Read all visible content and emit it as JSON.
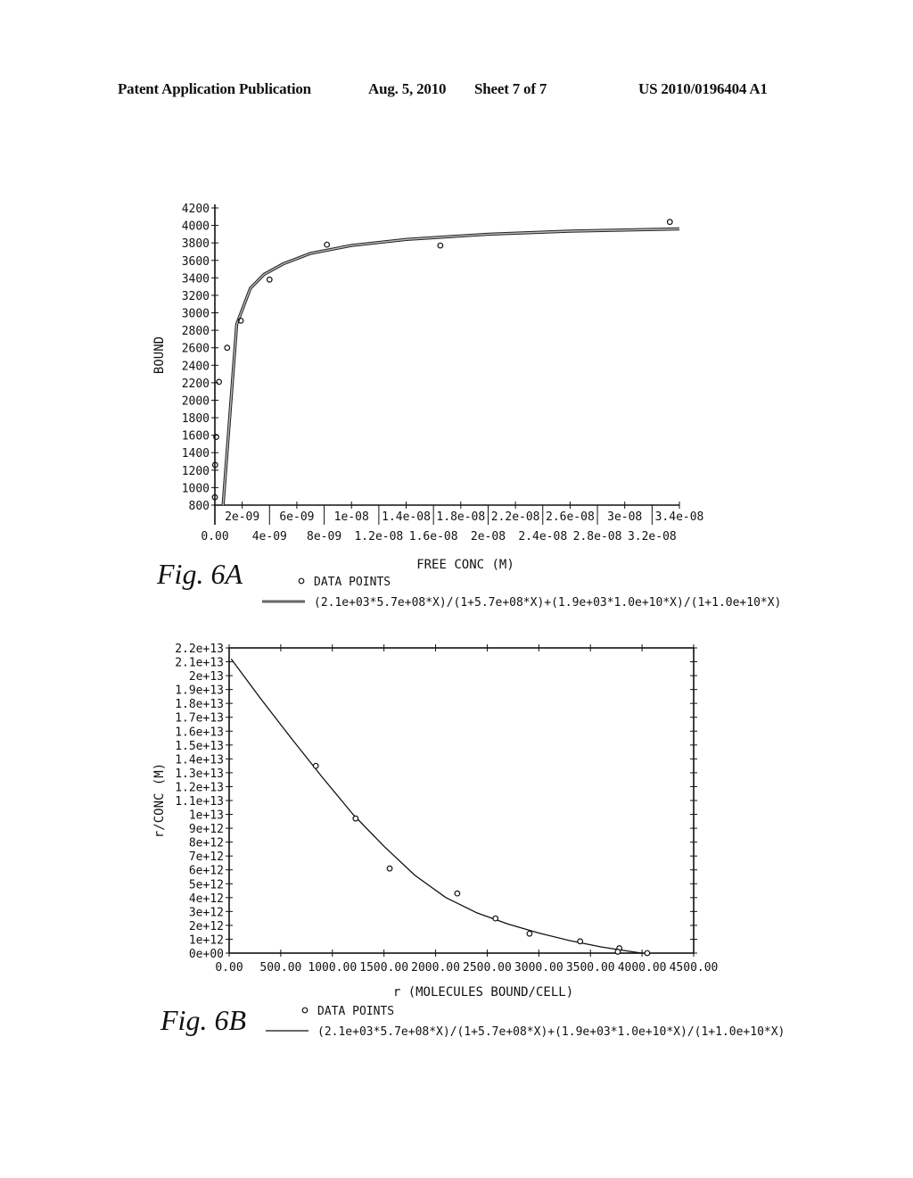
{
  "header": {
    "publication": "Patent Application Publication",
    "date": "Aug. 5, 2010",
    "sheet": "Sheet 7 of 7",
    "number": "US 2010/0196404 A1"
  },
  "chart_data": [
    {
      "id": "fig6a",
      "figure_label": "Fig. 6A",
      "type": "scatter",
      "title": "",
      "xlabel": "FREE CONC (M)",
      "ylabel": "BOUND",
      "xlim": [
        0,
        3.4e-08
      ],
      "ylim": [
        800,
        4200
      ],
      "grid": false,
      "x_ticks_lower": [
        "0.00",
        "4e-09",
        "8e-09",
        "1.2e-08",
        "1.6e-08",
        "2e-08",
        "2.4e-08",
        "2.8e-08",
        "3.2e-08"
      ],
      "x_ticks_lower_values": [
        0,
        4e-09,
        8e-09,
        1.2e-08,
        1.6e-08,
        2e-08,
        2.4e-08,
        2.8e-08,
        3.2e-08
      ],
      "x_ticks_upper": [
        "2e-09",
        "6e-09",
        "1e-08",
        "1.4e-08",
        "1.8e-08",
        "2.2e-08",
        "2.6e-08",
        "3e-08",
        "3.4e-08"
      ],
      "x_ticks_upper_values": [
        2e-09,
        6e-09,
        1e-08,
        1.4e-08,
        1.8e-08,
        2.2e-08,
        2.6e-08,
        3e-08,
        3.4e-08
      ],
      "y_ticks": [
        "800",
        "1000",
        "1200",
        "1400",
        "1600",
        "1800",
        "2000",
        "2200",
        "2400",
        "2600",
        "2800",
        "3000",
        "3200",
        "3400",
        "3600",
        "3800",
        "4000",
        "4200"
      ],
      "y_tick_values": [
        800,
        1000,
        1200,
        1400,
        1600,
        1800,
        2000,
        2200,
        2400,
        2600,
        2800,
        3000,
        3200,
        3400,
        3600,
        3800,
        4000,
        4200
      ],
      "series": [
        {
          "name": "DATA POINTS",
          "kind": "points",
          "x": [
            0,
            2e-11,
            1e-10,
            3e-10,
            9e-10,
            1.9e-09,
            4e-09,
            8.2e-09,
            1.65e-08,
            3.33e-08
          ],
          "y": [
            890,
            1260,
            1580,
            2210,
            2600,
            2910,
            3380,
            3780,
            3770,
            4040
          ]
        },
        {
          "name": "(2.1e+03*5.7e+08*X)/(1+5.7e+08*X)+(1.9e+03*1.0e+10*X)/(1+1.0e+10*X)",
          "kind": "fit-line",
          "x": [
            6e-10,
            1.6e-09,
            2.6e-09,
            3.6e-09,
            5e-09,
            7e-09,
            1e-08,
            1.4e-08,
            2e-08,
            2.6e-08,
            3.4e-08
          ],
          "y": [
            800,
            2870,
            3280,
            3440,
            3560,
            3680,
            3770,
            3840,
            3900,
            3935,
            3960
          ]
        }
      ],
      "legend": {
        "position": "bottom",
        "entries": [
          "DATA POINTS",
          "(2.1e+03*5.7e+08*X)/(1+5.7e+08*X)+(1.9e+03*1.0e+10*X)/(1+1.0e+10*X)"
        ]
      },
      "colors": {
        "fit": "#555555",
        "points": "#111111",
        "axis": "#111111"
      }
    },
    {
      "id": "fig6b",
      "figure_label": "Fig. 6B",
      "type": "scatter",
      "title": "",
      "xlabel": "r (MOLECULES BOUND/CELL)",
      "ylabel": "r/CONC (M)",
      "xlim": [
        0,
        4500
      ],
      "ylim": [
        0,
        22000000000000.0
      ],
      "grid": false,
      "x_ticks": [
        "0.00",
        "500.00",
        "1000.00",
        "1500.00",
        "2000.00",
        "2500.00",
        "3000.00",
        "3500.00",
        "4000.00",
        "4500.00"
      ],
      "x_tick_values": [
        0,
        500,
        1000,
        1500,
        2000,
        2500,
        3000,
        3500,
        4000,
        4500
      ],
      "y_ticks": [
        "0e+00",
        "1e+12",
        "2e+12",
        "3e+12",
        "4e+12",
        "5e+12",
        "6e+12",
        "7e+12",
        "8e+12",
        "9e+12",
        "1e+13",
        "1.1e+13",
        "1.2e+13",
        "1.3e+13",
        "1.4e+13",
        "1.5e+13",
        "1.6e+13",
        "1.7e+13",
        "1.8e+13",
        "1.9e+13",
        "2e+13",
        "2.1e+13",
        "2.2e+13"
      ],
      "y_tick_values": [
        0,
        1000000000000.0,
        2000000000000.0,
        3000000000000.0,
        4000000000000.0,
        5000000000000.0,
        6000000000000.0,
        7000000000000.0,
        8000000000000.0,
        9000000000000.0,
        10000000000000.0,
        11000000000000.0,
        12000000000000.0,
        13000000000000.0,
        14000000000000.0,
        15000000000000.0,
        16000000000000.0,
        17000000000000.0,
        18000000000000.0,
        19000000000000.0,
        20000000000000.0,
        21000000000000.0,
        22000000000000.0
      ],
      "series": [
        {
          "name": "DATA POINTS",
          "kind": "points",
          "x": [
            840,
            1225,
            1555,
            2210,
            2580,
            2910,
            3400,
            3780,
            3765,
            4050
          ],
          "y": [
            13500000000000.0,
            9700000000000.0,
            6100000000000.0,
            4300000000000.0,
            2500000000000.0,
            1400000000000.0,
            850000000000.0,
            350000000000.0,
            100000000000.0,
            0
          ]
        },
        {
          "name": "(2.1e+03*5.7e+08*X)/(1+5.7e+08*X)+(1.9e+03*1.0e+10*X)/(1+1.0e+10*X)",
          "kind": "fit-line",
          "x": [
            20,
            300,
            600,
            900,
            1200,
            1500,
            1800,
            2100,
            2400,
            2700,
            3000,
            3300,
            3600,
            3900,
            4000
          ],
          "y": [
            21200000000000.0,
            18400000000000.0,
            15500000000000.0,
            12700000000000.0,
            10000000000000.0,
            7700000000000.0,
            5600000000000.0,
            4000000000000.0,
            2900000000000.0,
            2100000000000.0,
            1450000000000.0,
            900000000000.0,
            450000000000.0,
            100000000000.0,
            0
          ]
        }
      ],
      "legend": {
        "position": "bottom",
        "entries": [
          "DATA POINTS",
          "(2.1e+03*5.7e+08*X)/(1+5.7e+08*X)+(1.9e+03*1.0e+10*X)/(1+1.0e+10*X)"
        ]
      },
      "colors": {
        "fit": "#111111",
        "points": "#111111",
        "axis": "#111111"
      }
    }
  ]
}
